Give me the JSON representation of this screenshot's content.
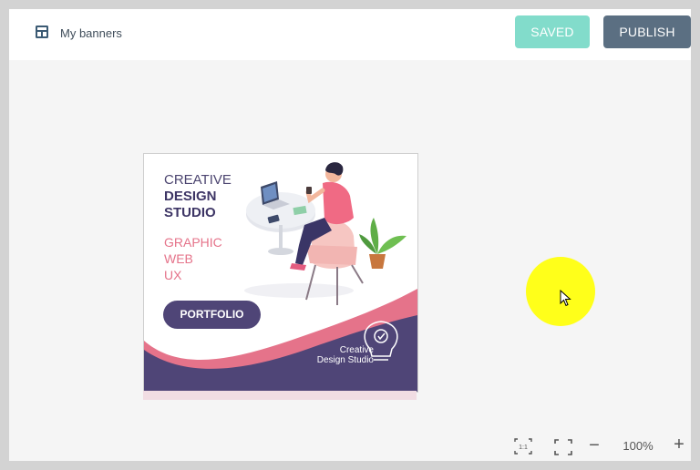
{
  "header": {
    "title": "My banners",
    "layout_icon": "layout-template-icon",
    "saved_label": "SAVED",
    "publish_label": "PUBLISH"
  },
  "banner": {
    "headline": [
      "CREATIVE",
      "DESIGN",
      "STUDIO"
    ],
    "services": [
      "GRAPHIC",
      "WEB",
      "UX"
    ],
    "cta_label": "PORTFOLIO",
    "footer_text": [
      "Creative",
      "Design Studio"
    ],
    "footer_icon": "lightbulb-gear-icon",
    "illustration": "person-in-chair-with-laptop-illustration"
  },
  "zoom": {
    "actual_size_icon": "one-to-one-icon",
    "fit_icon": "fit-screen-icon",
    "minus_label": "−",
    "level": "100%",
    "plus_label": "+"
  },
  "colors": {
    "saved": "#82dccb",
    "publish": "#5b6f82",
    "banner_purple": "#4f4577",
    "banner_pink": "#e5738a",
    "highlight": "#ffff1a"
  }
}
